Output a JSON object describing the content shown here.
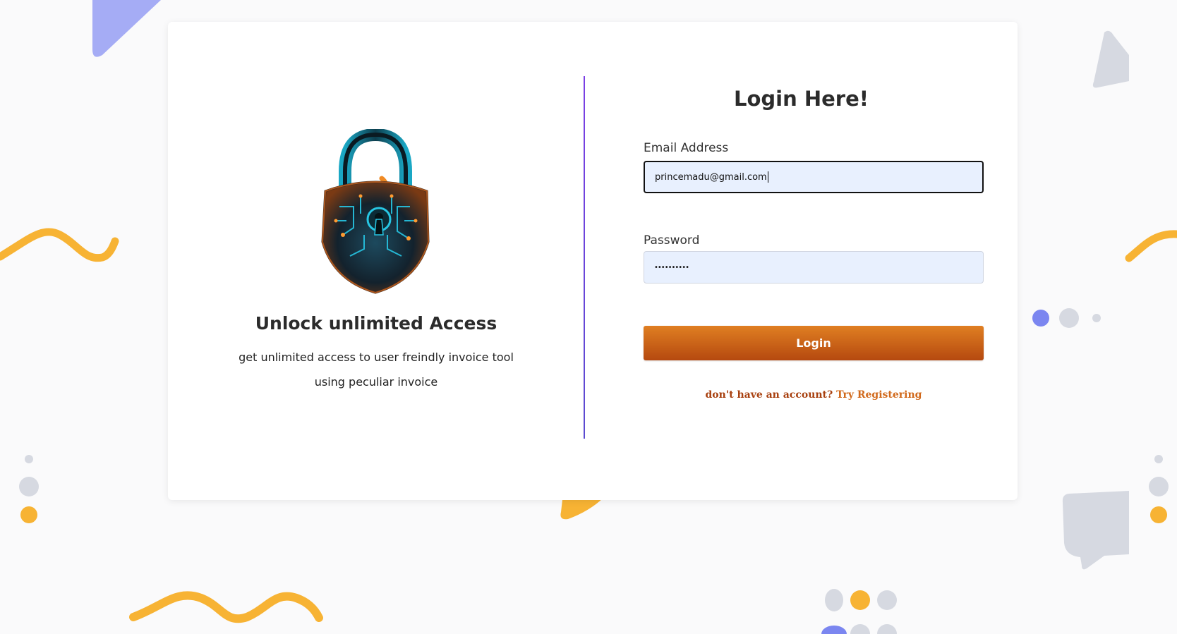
{
  "left": {
    "title": "Unlock unlimited Access",
    "subtitle_line1": "get unlimited access to user freindly invoice tool",
    "subtitle_line2": "using peculiar invoice"
  },
  "form": {
    "title": "Login Here!",
    "email_label": "Email Address",
    "email_value": "princemadu@gmail.com",
    "password_label": "Password",
    "password_value": "••••••••••",
    "login_label": "Login",
    "no_account_text": "don't have an account?",
    "register_link": "Try Registering"
  },
  "icons": {
    "illustration": "padlock-icon"
  },
  "colors": {
    "background": "#fafafb",
    "card": "#ffffff",
    "button_start": "#e07f22",
    "button_end": "#b5490f",
    "divider": "#6a45dc",
    "input_fill": "#e8f0fe",
    "deco_yellow": "#f7b334",
    "deco_blue": "#7b86f0",
    "deco_gray": "#d6d9e1"
  }
}
